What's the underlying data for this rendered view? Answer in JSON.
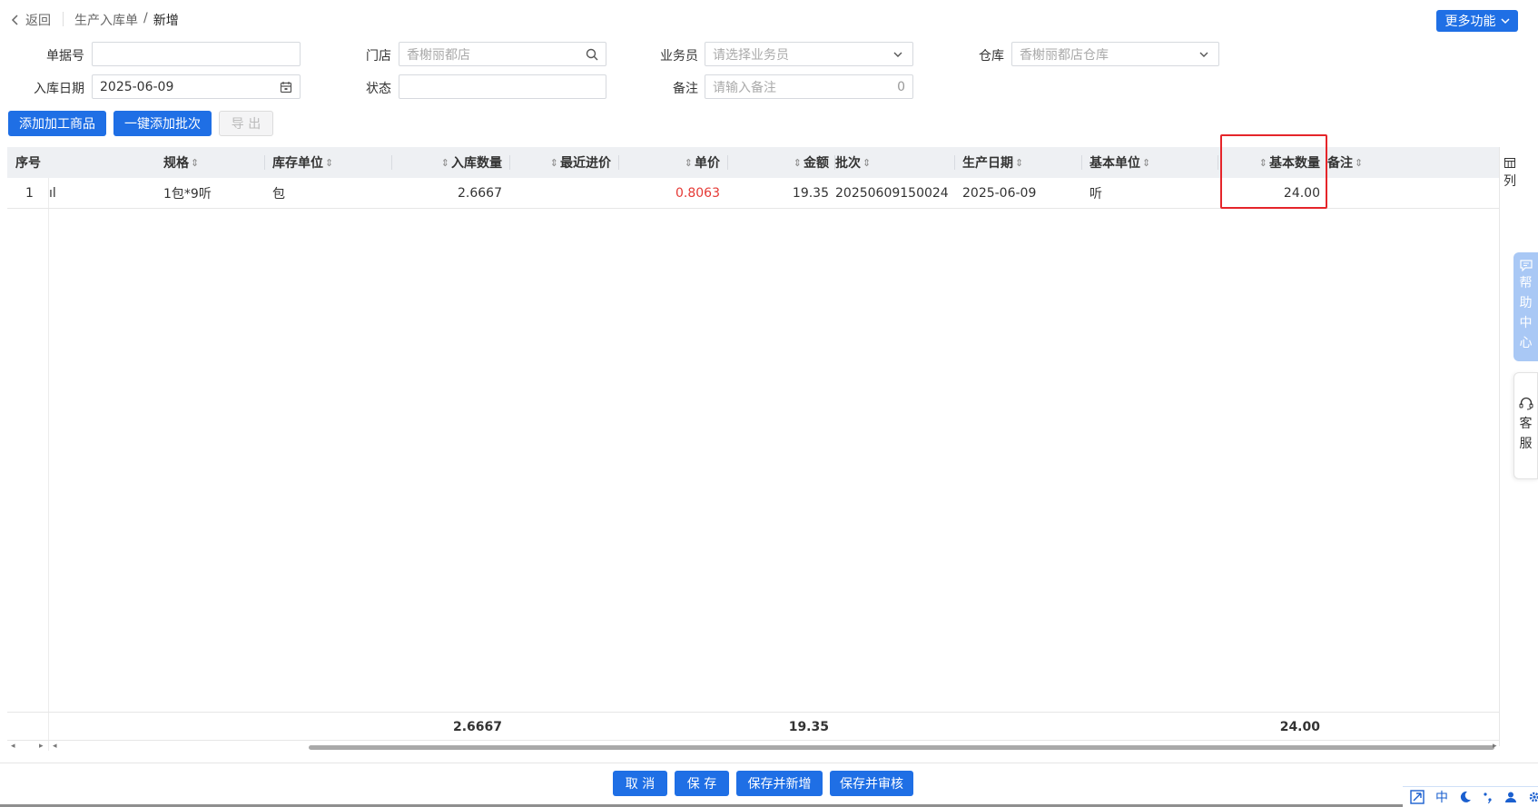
{
  "header": {
    "back_label": "返回",
    "breadcrumb": [
      "生产入库单",
      "/",
      "新增"
    ],
    "more_button": "更多功能"
  },
  "form": {
    "doc_no": {
      "label": "单据号",
      "value": ""
    },
    "store": {
      "label": "门店",
      "value": "香榭丽都店"
    },
    "salesman": {
      "label": "业务员",
      "placeholder": "请选择业务员"
    },
    "warehouse": {
      "label": "仓库",
      "value": "香榭丽都店仓库"
    },
    "in_date": {
      "label": "入库日期",
      "value": "2025-06-09"
    },
    "status": {
      "label": "状态",
      "value": ""
    },
    "remark": {
      "label": "备注",
      "placeholder": "请输入备注",
      "count": "0"
    }
  },
  "toolbar": {
    "add_goods": "添加加工商品",
    "add_batch": "一键添加批次",
    "export": "导 出"
  },
  "table": {
    "columns": {
      "seq": "序号",
      "spec": "规格",
      "stock_unit": "库存单位",
      "in_qty": "入库数量",
      "last_price": "最近进价",
      "unit_price": "单价",
      "amount": "金额",
      "batch": "批次",
      "prod_date": "生产日期",
      "base_unit": "基本单位",
      "base_qty": "基本数量",
      "remark": "备注"
    },
    "rows": [
      {
        "seq": "1",
        "name_fragment": "ıl",
        "spec": "1包*9听",
        "stock_unit": "包",
        "in_qty": "2.6667",
        "last_price": "",
        "unit_price": "0.8063",
        "amount": "19.35",
        "batch": "20250609150024",
        "prod_date": "2025-06-09",
        "base_unit": "听",
        "base_qty": "24.00",
        "remark": ""
      }
    ],
    "totals": {
      "in_qty": "2.6667",
      "amount": "19.35",
      "base_qty": "24.00"
    },
    "column_settings": "列"
  },
  "side": {
    "help": [
      "帮",
      "助",
      "中",
      "心"
    ],
    "service": [
      "客",
      "服"
    ]
  },
  "footer": {
    "cancel": "取 消",
    "save": "保 存",
    "save_new": "保存并新增",
    "save_audit": "保存并审核"
  },
  "ime": {
    "lang": "中"
  },
  "colors": {
    "primary": "#1f6fe5",
    "highlight": "#e5252a",
    "price": "#e53935"
  }
}
